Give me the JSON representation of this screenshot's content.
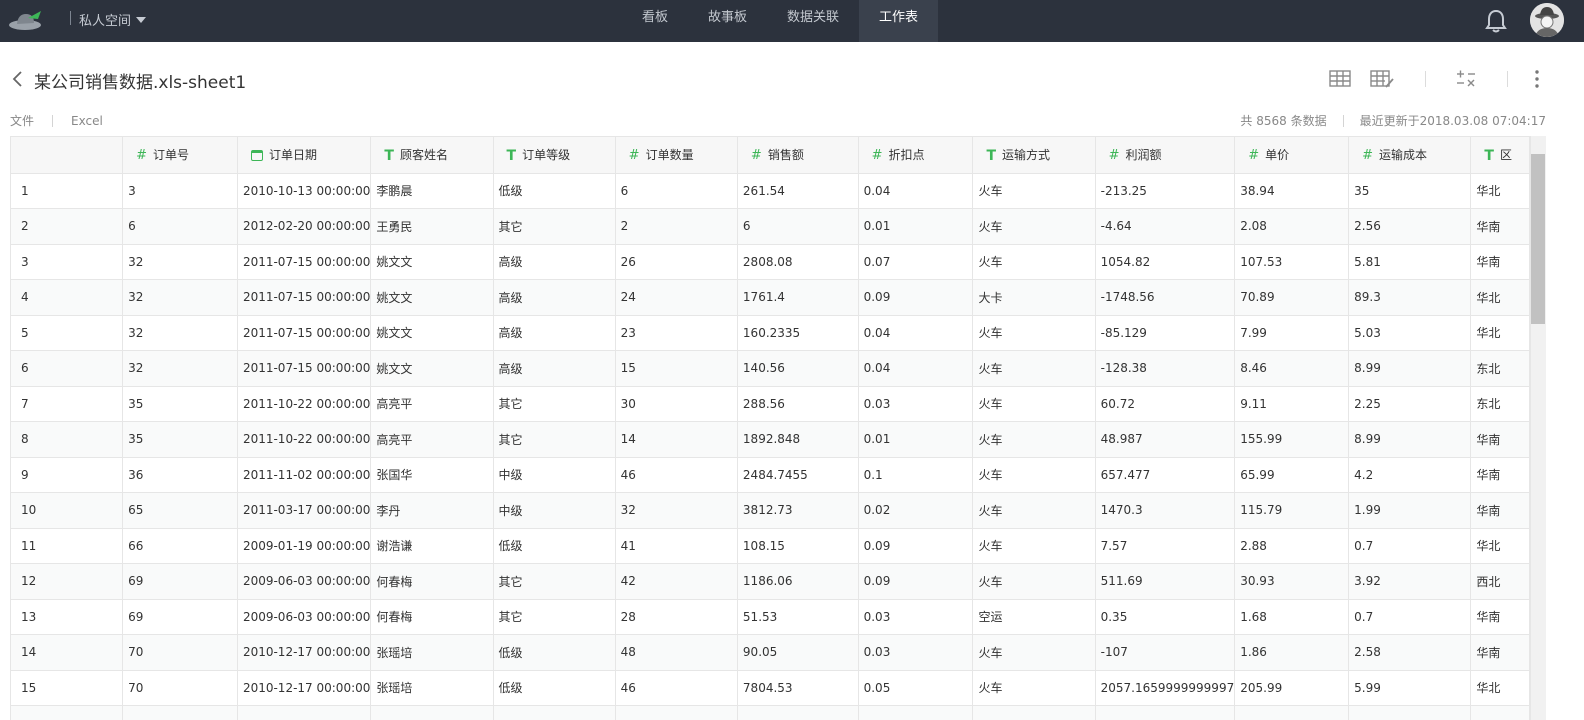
{
  "header": {
    "space_label": "私人空间",
    "nav": [
      "看板",
      "故事板",
      "数据关联",
      "工作表"
    ],
    "active_nav": 3
  },
  "page": {
    "title": "某公司销售数据.xls-sheet1",
    "meta_left": [
      "文件",
      "Excel"
    ],
    "record_count": "共 8568 条数据",
    "last_updated": "最近更新于2018.03.08 07:04:17"
  },
  "table": {
    "columns": [
      {
        "label": "",
        "type": "none"
      },
      {
        "label": "订单号",
        "type": "num"
      },
      {
        "label": "订单日期",
        "type": "date"
      },
      {
        "label": "顾客姓名",
        "type": "text"
      },
      {
        "label": "订单等级",
        "type": "text"
      },
      {
        "label": "订单数量",
        "type": "num"
      },
      {
        "label": "销售额",
        "type": "num"
      },
      {
        "label": "折扣点",
        "type": "num"
      },
      {
        "label": "运输方式",
        "type": "text"
      },
      {
        "label": "利润额",
        "type": "num"
      },
      {
        "label": "单价",
        "type": "num"
      },
      {
        "label": "运输成本",
        "type": "num"
      },
      {
        "label": "区",
        "type": "text"
      }
    ],
    "rows": [
      [
        "1",
        "3",
        "2010-10-13 00:00:00",
        "李鹏晨",
        "低级",
        "6",
        "261.54",
        "0.04",
        "火车",
        "-213.25",
        "38.94",
        "35",
        "华北"
      ],
      [
        "2",
        "6",
        "2012-02-20 00:00:00",
        "王勇民",
        "其它",
        "2",
        "6",
        "0.01",
        "火车",
        "-4.64",
        "2.08",
        "2.56",
        "华南"
      ],
      [
        "3",
        "32",
        "2011-07-15 00:00:00",
        "姚文文",
        "高级",
        "26",
        "2808.08",
        "0.07",
        "火车",
        "1054.82",
        "107.53",
        "5.81",
        "华南"
      ],
      [
        "4",
        "32",
        "2011-07-15 00:00:00",
        "姚文文",
        "高级",
        "24",
        "1761.4",
        "0.09",
        "大卡",
        "-1748.56",
        "70.89",
        "89.3",
        "华北"
      ],
      [
        "5",
        "32",
        "2011-07-15 00:00:00",
        "姚文文",
        "高级",
        "23",
        "160.2335",
        "0.04",
        "火车",
        "-85.129",
        "7.99",
        "5.03",
        "华北"
      ],
      [
        "6",
        "32",
        "2011-07-15 00:00:00",
        "姚文文",
        "高级",
        "15",
        "140.56",
        "0.04",
        "火车",
        "-128.38",
        "8.46",
        "8.99",
        "东北"
      ],
      [
        "7",
        "35",
        "2011-10-22 00:00:00",
        "高亮平",
        "其它",
        "30",
        "288.56",
        "0.03",
        "火车",
        "60.72",
        "9.11",
        "2.25",
        "东北"
      ],
      [
        "8",
        "35",
        "2011-10-22 00:00:00",
        "高亮平",
        "其它",
        "14",
        "1892.848",
        "0.01",
        "火车",
        "48.987",
        "155.99",
        "8.99",
        "华南"
      ],
      [
        "9",
        "36",
        "2011-11-02 00:00:00",
        "张国华",
        "中级",
        "46",
        "2484.7455",
        "0.1",
        "火车",
        "657.477",
        "65.99",
        "4.2",
        "华南"
      ],
      [
        "10",
        "65",
        "2011-03-17 00:00:00",
        "李丹",
        "中级",
        "32",
        "3812.73",
        "0.02",
        "火车",
        "1470.3",
        "115.79",
        "1.99",
        "华南"
      ],
      [
        "11",
        "66",
        "2009-01-19 00:00:00",
        "谢浩谦",
        "低级",
        "41",
        "108.15",
        "0.09",
        "火车",
        "7.57",
        "2.88",
        "0.7",
        "华北"
      ],
      [
        "12",
        "69",
        "2009-06-03 00:00:00",
        "何春梅",
        "其它",
        "42",
        "1186.06",
        "0.09",
        "火车",
        "511.69",
        "30.93",
        "3.92",
        "西北"
      ],
      [
        "13",
        "69",
        "2009-06-03 00:00:00",
        "何春梅",
        "其它",
        "28",
        "51.53",
        "0.03",
        "空运",
        "0.35",
        "1.68",
        "0.7",
        "华南"
      ],
      [
        "14",
        "70",
        "2010-12-17 00:00:00",
        "张瑶培",
        "低级",
        "48",
        "90.05",
        "0.03",
        "火车",
        "-107",
        "1.86",
        "2.58",
        "华南"
      ],
      [
        "15",
        "70",
        "2010-12-17 00:00:00",
        "张瑶培",
        "低级",
        "46",
        "7804.53",
        "0.05",
        "火车",
        "2057.1659999999997",
        "205.99",
        "5.99",
        "华北"
      ],
      [
        "",
        "",
        "",
        "",
        "",
        "",
        "",
        "",
        "",
        "",
        "",
        "",
        ""
      ]
    ]
  },
  "icons": {
    "logo": "hat-logo-icon",
    "bell": "bell-icon",
    "avatar": "avatar-icon",
    "back": "back-chevron-icon",
    "tools": [
      "table-view-icon",
      "table-edit-icon",
      "calculate-field-icon",
      "more-vertical-icon"
    ],
    "column_types": {
      "num": "number-type-icon",
      "date": "date-type-icon",
      "text": "text-type-icon"
    }
  },
  "colors": {
    "topbar": "#2c323d",
    "accent_green": "#3db657"
  }
}
